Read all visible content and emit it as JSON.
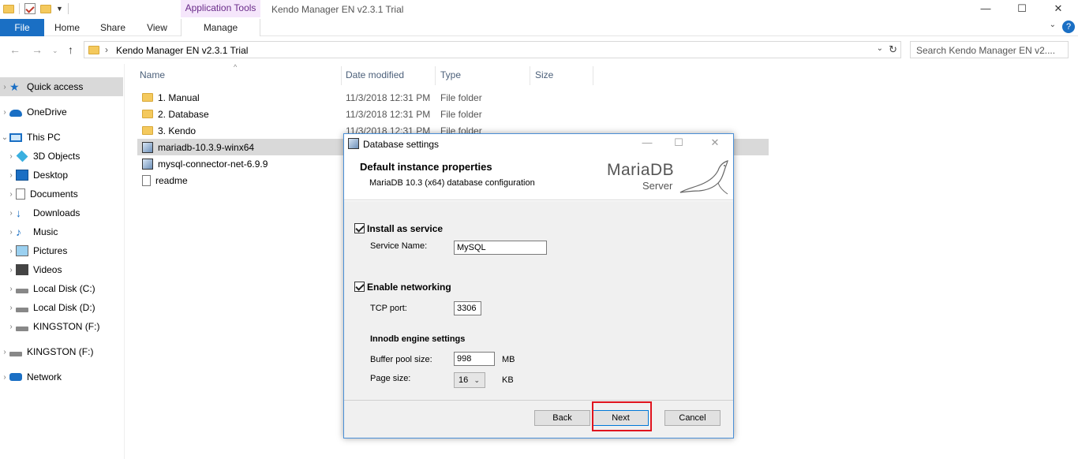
{
  "window": {
    "title": "Kendo Manager EN v2.3.1 Trial",
    "context_tab_group": "Application Tools",
    "controls": {
      "minimize": "—",
      "maximize": "☐",
      "close": "✕"
    }
  },
  "ribbon": {
    "tabs": [
      {
        "label": "File",
        "active": true
      },
      {
        "label": "Home"
      },
      {
        "label": "Share"
      },
      {
        "label": "View"
      },
      {
        "label": "Manage"
      }
    ],
    "help": "?"
  },
  "address_bar": {
    "path": "Kendo Manager EN v2.3.1 Trial",
    "search_placeholder": "Search Kendo Manager EN v2...."
  },
  "nav_pane": {
    "items": [
      {
        "label": "Quick access",
        "icon": "star-icon",
        "selected": true
      },
      {
        "label": "OneDrive",
        "icon": "cloud-icon"
      },
      {
        "label": "This PC",
        "icon": "computer-icon",
        "expanded": true
      },
      {
        "label": "3D Objects",
        "icon": "cube-icon"
      },
      {
        "label": "Desktop",
        "icon": "desktop-icon"
      },
      {
        "label": "Documents",
        "icon": "document-icon"
      },
      {
        "label": "Downloads",
        "icon": "download-icon"
      },
      {
        "label": "Music",
        "icon": "music-icon"
      },
      {
        "label": "Pictures",
        "icon": "picture-icon"
      },
      {
        "label": "Videos",
        "icon": "video-icon"
      },
      {
        "label": "Local Disk (C:)",
        "icon": "disk-icon"
      },
      {
        "label": "Local Disk (D:)",
        "icon": "disk-icon"
      },
      {
        "label": "KINGSTON (F:)",
        "icon": "usb-drive-icon"
      },
      {
        "label": "KINGSTON (F:)",
        "icon": "usb-drive-icon"
      },
      {
        "label": "Network",
        "icon": "network-icon"
      }
    ]
  },
  "file_list": {
    "columns": [
      "Name",
      "Date modified",
      "Type",
      "Size"
    ],
    "rows": [
      {
        "name": "1. Manual",
        "date": "11/3/2018 12:31 PM",
        "type": "File folder",
        "icon": "folder-icon"
      },
      {
        "name": "2. Database",
        "date": "11/3/2018 12:31 PM",
        "type": "File folder",
        "icon": "folder-icon"
      },
      {
        "name": "3. Kendo",
        "date": "11/3/2018 12:31 PM",
        "type": "File folder",
        "icon": "folder-icon"
      },
      {
        "name": "mariadb-10.3.9-winx64",
        "icon": "installer-icon",
        "selected": true
      },
      {
        "name": "mysql-connector-net-6.9.9",
        "icon": "installer-icon"
      },
      {
        "name": "readme",
        "icon": "text-file-icon"
      }
    ]
  },
  "dialog": {
    "title": "Database settings",
    "heading": "Default instance properties",
    "subheading": "MariaDB 10.3 (x64) database configuration",
    "logo": {
      "brand": "MariaDB",
      "product": "Server"
    },
    "install_service": {
      "label": "Install as service",
      "checked": true,
      "service_name_label": "Service Name:",
      "service_name": "MySQL"
    },
    "networking": {
      "label": "Enable networking",
      "checked": true,
      "port_label": "TCP port:",
      "port": "3306"
    },
    "innodb": {
      "heading": "Innodb engine settings",
      "buffer_label": "Buffer pool size:",
      "buffer_value": "998",
      "buffer_unit": "MB",
      "page_label": "Page size:",
      "page_value": "16",
      "page_unit": "KB"
    },
    "buttons": {
      "back": "Back",
      "next": "Next",
      "cancel": "Cancel"
    },
    "highlight_color": "#e0141e"
  }
}
